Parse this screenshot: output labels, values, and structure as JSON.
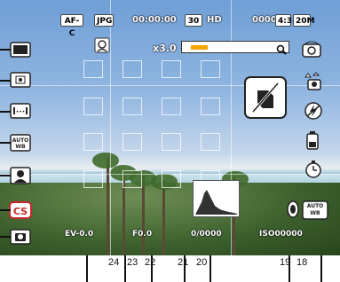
{
  "top_bar": {
    "af_mode": "AF-C",
    "format": "JPG",
    "record_time": "00:00:00",
    "fps": "30",
    "video_quality": "HD",
    "shots_remaining": "0000",
    "aspect": "4:3",
    "resolution": "20M"
  },
  "zoom": {
    "label": "x3.0",
    "level": 0.2
  },
  "bottom_info": {
    "ev": "EV-0.0",
    "focal": "F0.0",
    "shutter": "0/0000",
    "iso": "ISO00000",
    "white_balance": "AUTO WB"
  },
  "left_icons": [
    {
      "name": "single-shot-icon"
    },
    {
      "name": "metering-icon"
    },
    {
      "name": "focus-area-icon"
    },
    {
      "name": "auto-wb-icon",
      "label": "AUTO WB"
    },
    {
      "name": "face-detect-icon"
    },
    {
      "name": "color-setting-icon",
      "label": "CS"
    },
    {
      "name": "scene-mode-icon"
    }
  ],
  "right_icons": [
    {
      "name": "stabilizer-icon"
    },
    {
      "name": "drive-mode-icon"
    },
    {
      "name": "flash-off-icon"
    },
    {
      "name": "battery-icon"
    },
    {
      "name": "self-timer-icon"
    }
  ],
  "callout_numbers": {
    "n24": "24",
    "n23": "23",
    "n22": "22",
    "n21": "21",
    "n20": "20",
    "n19": "19",
    "n18": "18"
  },
  "colors": {
    "accent": "#c62828",
    "badge_bg": "#ffffff"
  }
}
